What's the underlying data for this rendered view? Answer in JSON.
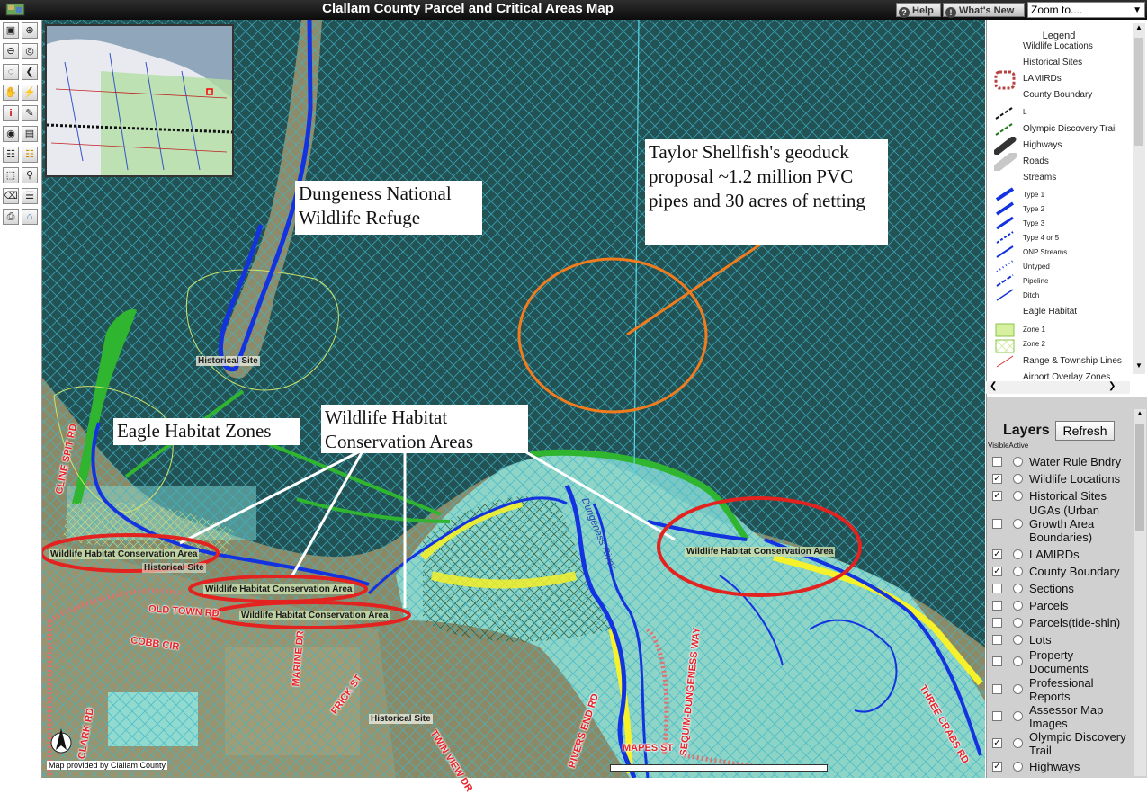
{
  "window": {
    "title": "Clallam County Parcel and Critical Areas Map"
  },
  "header": {
    "help_label": "Help",
    "whats_new_label": "What's New",
    "zoom_select_value": "Zoom to...."
  },
  "toolbar": {
    "icons": [
      "legend-toggle-icon",
      "zoom-in-icon",
      "zoom-out-icon",
      "zoom-full-icon",
      "zoom-previous-icon",
      "back-icon",
      "pan-icon",
      "refresh-lightning-icon",
      "identify-icon",
      "edit-icon",
      "search-binoculars-icon",
      "print-setup-icon",
      "table-icon",
      "grid-icon",
      "select-icon",
      "query-icon",
      "erase-icon",
      "layer-list-icon",
      "print-icon",
      "home-icon"
    ]
  },
  "map": {
    "annotations": {
      "refuge": "Dungeness National Wildlife Refuge",
      "geoduck": "Taylor Shellfish's geoduck proposal ~1.2 million PVC pipes and 30 acres of netting",
      "eagle": "Eagle Habitat Zones",
      "whca": "Wildlife Habitat Conservation Areas"
    },
    "labels": {
      "historical_site": "Historical Site",
      "whca_label": "Wildlife Habitat Conservation Area",
      "historical_site_partial": "Historical Site"
    },
    "streets": {
      "cline_spit": "CLINE SPIT RD",
      "old_town": "OLD TOWN RD",
      "cobb": "COBB CIR",
      "clark": "CLARK RD",
      "marine": "MARINE DR",
      "frick": "FRICK ST",
      "twin_view": "TWIN VIEW DR",
      "rivers_end": "RIVERS END RD",
      "sequim_dungeness": "SEQUIM-DUNGENESS WAY",
      "mapes": "MAPES ST",
      "three_crabs": "THREE CRABS RD",
      "river": "Dungeness River"
    },
    "provided_by": "Map provided by Clallam County",
    "colors": {
      "water_hatch": "#3bb6c8",
      "stream_blue": "#1433e0",
      "eagle_green": "#2fb52f",
      "habitat_red": "#e3231f",
      "orange_circle": "#f07c1e",
      "conservation_cyan": "#8fe6e0"
    }
  },
  "legend": {
    "title": "Legend",
    "items": [
      {
        "label": "Wildlife Locations"
      },
      {
        "label": "Historical Sites"
      },
      {
        "label": "LAMIRDs"
      },
      {
        "label": "County Boundary"
      },
      {
        "label": "L"
      },
      {
        "label": "Olympic Discovery Trail"
      },
      {
        "label": "Highways"
      },
      {
        "label": "Roads"
      },
      {
        "label": "Streams"
      },
      {
        "label": "Type 1"
      },
      {
        "label": "Type 2"
      },
      {
        "label": "Type 3"
      },
      {
        "label": "Type 4 or 5"
      },
      {
        "label": "ONP Streams"
      },
      {
        "label": "Untyped"
      },
      {
        "label": "Pipeline"
      },
      {
        "label": "Ditch"
      },
      {
        "label": "Eagle Habitat"
      },
      {
        "label": "Zone 1"
      },
      {
        "label": "Zone 2"
      },
      {
        "label": "Range & Township Lines"
      },
      {
        "label": "Airport Overlay Zones"
      }
    ]
  },
  "layers": {
    "title": "Layers",
    "refresh_label": "Refresh",
    "header": "VisibleActive",
    "items": [
      {
        "label": "Water Rule Bndry",
        "checked": false
      },
      {
        "label": "Wildlife Locations",
        "checked": true
      },
      {
        "label": "Historical Sites",
        "checked": true
      },
      {
        "label": "UGAs (Urban Growth Area Boundaries)",
        "checked": false
      },
      {
        "label": "LAMIRDs",
        "checked": true
      },
      {
        "label": "County Boundary",
        "checked": true
      },
      {
        "label": "Sections",
        "checked": false
      },
      {
        "label": "Parcels",
        "checked": false
      },
      {
        "label": "Parcels(tide-shln)",
        "checked": false
      },
      {
        "label": "Lots",
        "checked": false
      },
      {
        "label": "Property-Documents",
        "checked": false
      },
      {
        "label": "Professional Reports",
        "checked": false
      },
      {
        "label": "Assessor Map Images",
        "checked": false
      },
      {
        "label": "Olympic Discovery Trail",
        "checked": true
      },
      {
        "label": "Highways",
        "checked": true
      }
    ]
  }
}
